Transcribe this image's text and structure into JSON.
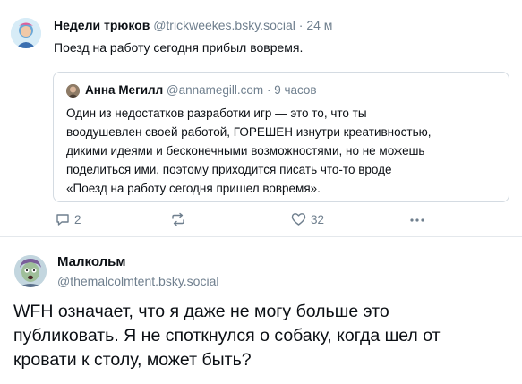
{
  "post1": {
    "author_name": "Недели трюков",
    "author_handle": "@trickweekes.bsky.social",
    "separator": "·",
    "time": "24 м",
    "text": "Поезд на работу сегодня прибыл вовремя."
  },
  "quote": {
    "author_name": "Анна Мегилл",
    "author_handle": "@annamegill.com",
    "separator": "·",
    "time": "9 часов",
    "lines": [
      "Один из недостатков разработки игр — это то, что ты",
      "воодушевлен своей работой, ГОРЕШЕН изнутри креативностью,",
      "дикими идеями и бесконечными возможностями, но не можешь",
      "поделиться ими, поэтому приходится писать что-то вроде",
      "«Поезд на работу сегодня пришел вовремя»."
    ]
  },
  "actions": {
    "reply_count": "2",
    "repost_count": "",
    "like_count": "32",
    "icons": [
      "reply-icon",
      "repost-icon",
      "like-icon",
      "more-icon"
    ]
  },
  "post2": {
    "author_name": "Малкольм",
    "author_handle": "@themalcolmtent.bsky.social",
    "lines": [
      "WFH означает, что я даже не могу больше это",
      "публиковать. Я не споткнулся о собаку, когда шел от",
      "кровати к столу, может быть?"
    ]
  },
  "colors": {
    "text": "#0b0f14",
    "muted": "#6f7f8e",
    "border": "#d4dbe2"
  }
}
